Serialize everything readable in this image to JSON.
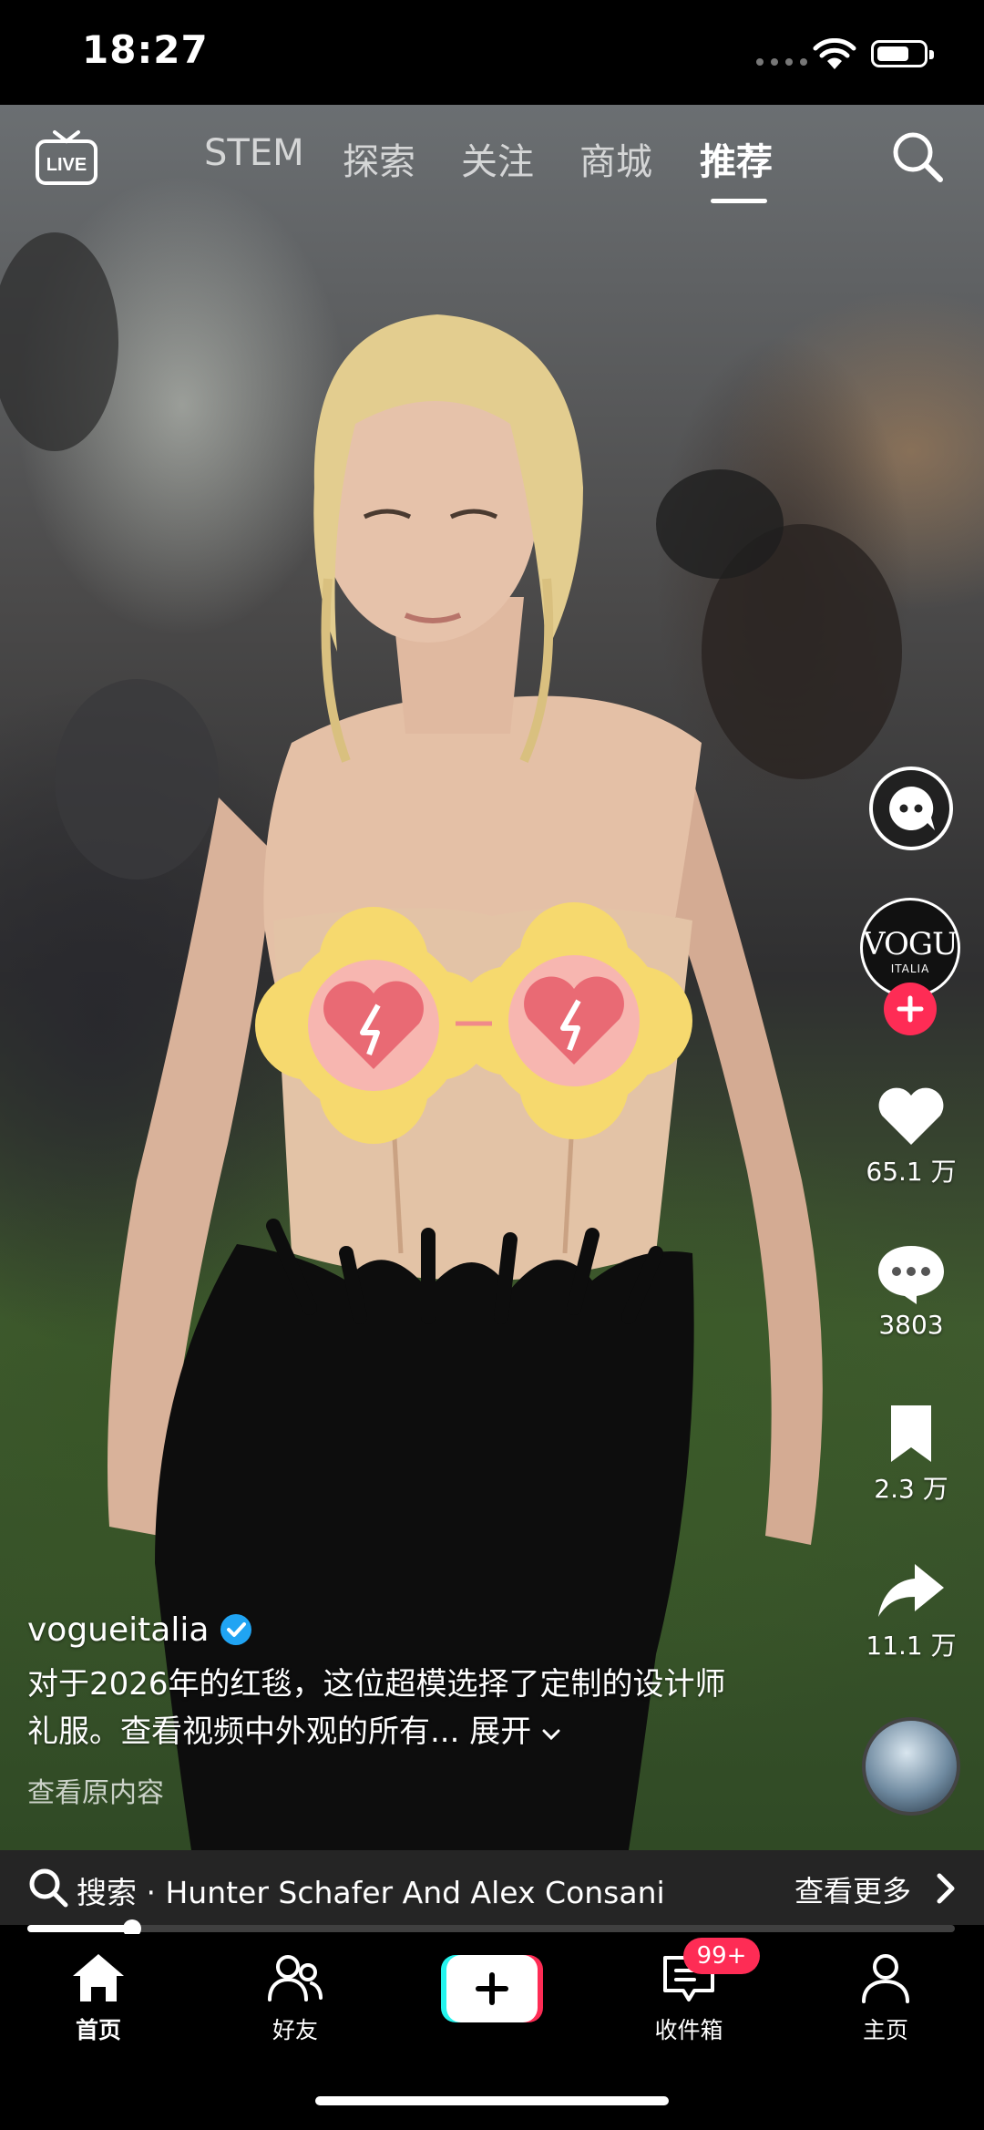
{
  "status_bar": {
    "time": "18:27"
  },
  "top_nav": {
    "live_icon": "live-tv-icon",
    "tabs": [
      {
        "label": "STEM",
        "active": false
      },
      {
        "label": "探索",
        "active": false
      },
      {
        "label": "关注",
        "active": false
      },
      {
        "label": "商城",
        "active": false
      },
      {
        "label": "推荐",
        "active": true
      }
    ],
    "search_icon": "search-icon"
  },
  "video": {
    "description": "video frame"
  },
  "action_rail": {
    "avatar_text": "VOGUE",
    "avatar_subtext": "ITALIA",
    "likes": "65.1 万",
    "comments": "3803",
    "favorites": "2.3 万",
    "shares": "11.1 万"
  },
  "caption": {
    "username": "vogueitalia",
    "text": "对于2026年的红毯，这位超模选择了定制的设计师礼服。查看视频中外观的所有...",
    "expand_label": "展开",
    "view_original": "查看原内容"
  },
  "search_bar": {
    "query": "搜索 · Hunter Schafer And Alex Consani",
    "more_label": "查看更多"
  },
  "progress": {
    "fraction": 0.113
  },
  "bottom_nav": {
    "items": [
      {
        "label": "首页",
        "active": true
      },
      {
        "label": "好友",
        "active": false
      },
      {
        "label": "收件箱",
        "active": false,
        "badge": "99+"
      },
      {
        "label": "主页",
        "active": false
      }
    ]
  },
  "colors": {
    "accent": "#fe2c55",
    "verified": "#20a4f3",
    "sticker": "#f6d96e",
    "heart": "#e96a74"
  }
}
